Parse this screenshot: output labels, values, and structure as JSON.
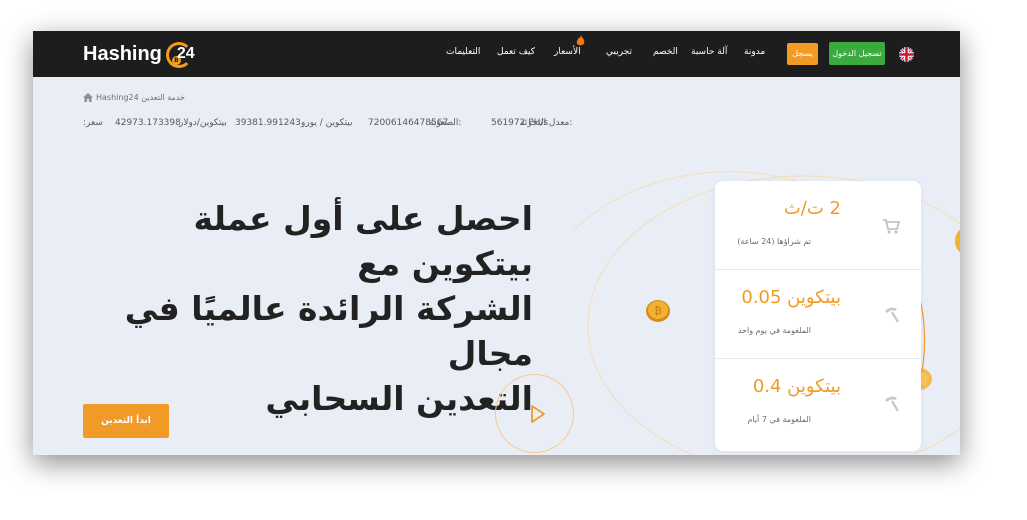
{
  "header": {
    "logo_text": "Hashing",
    "logo_number": "24",
    "menu": [
      {
        "label": "التعليمات",
        "id": "instructions"
      },
      {
        "label": "كيف تعمل",
        "id": "how-it-works"
      },
      {
        "label": "الأسعار",
        "id": "prices"
      },
      {
        "label": "تجريبي",
        "id": "trial"
      },
      {
        "label": "الخصم",
        "id": "discount"
      },
      {
        "label": "آلة حاسبة",
        "id": "calculator"
      },
      {
        "label": "مدونة",
        "id": "blog"
      }
    ],
    "signup_label": "يسجل",
    "login_label": "تسجيل الدخول",
    "language_flag": "uk-flag-icon"
  },
  "breadcrumb": {
    "home_icon": "home-icon",
    "text": "Hashing24 خدمة التعدين"
  },
  "stats": {
    "hashrate_label": "معدل التجزئة:",
    "hashrate_value": "561972 PH/s",
    "difficulty_label": "الصعوبة:",
    "difficulty_value": "72006146478567",
    "btc_eur_label": "بيتكوين / يورو",
    "btc_eur_value": "39381.991243",
    "btc_usd_label": "بيتكوين/دولار",
    "btc_usd_value": "42973.173398",
    "price_label": ":سعر"
  },
  "hero": {
    "title_lines": [
      "احصل على أول عملة بيتكوين مع",
      "الشركة الرائدة عالميًا في مجال",
      "التعدين السحابي"
    ],
    "start_label": "ابدأ التعدين"
  },
  "card": {
    "rows": [
      {
        "value": "2 ت/ث",
        "subtitle": "تم شراؤها (24 ساعة)",
        "icon": "cart-icon"
      },
      {
        "value": "بيتكوين 0.05",
        "subtitle": "الملغومة في يوم واحد",
        "icon": "pickaxe-icon"
      },
      {
        "value": "بيتكوين 0.4",
        "subtitle": "الملغومة في 7 أيام",
        "icon": "pickaxe-icon"
      }
    ]
  },
  "colors": {
    "accent": "#f29a26",
    "login_green": "#3bab40",
    "nav_bg": "#1d1d1d",
    "page_bg": "#e9eef6"
  }
}
